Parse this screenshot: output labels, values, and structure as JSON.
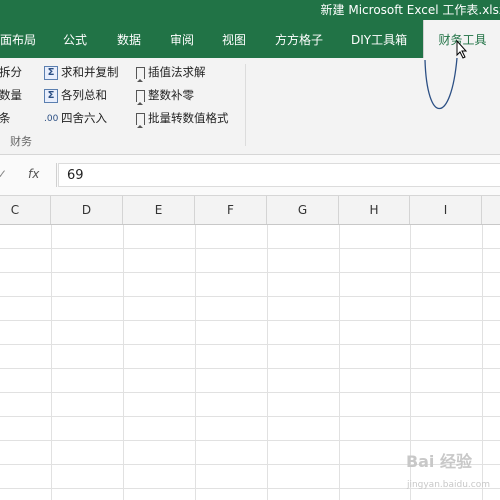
{
  "window": {
    "title": "新建 Microsoft Excel 工作表.xlsx"
  },
  "tabs": [
    {
      "label": "页面布局"
    },
    {
      "label": "公式"
    },
    {
      "label": "数据"
    },
    {
      "label": "审阅"
    },
    {
      "label": "视图"
    },
    {
      "label": "方方格子"
    },
    {
      "label": "DIY工具箱"
    },
    {
      "label": "财务工具",
      "active": true
    }
  ],
  "ribbon": {
    "left_items": [
      "拆分",
      "数量",
      "条"
    ],
    "group_label": "财务",
    "col2": [
      {
        "label": "求和并复制",
        "icon": "sigma-icon"
      },
      {
        "label": "各列总和",
        "icon": "sigma-icon"
      },
      {
        "label": "四舍六入",
        "icon": "round-icon"
      }
    ],
    "col3": [
      {
        "label": "插值法求解",
        "icon": "bookmark-icon"
      },
      {
        "label": "整数补零",
        "icon": "bookmark-icon"
      },
      {
        "label": "批量转数值格式",
        "icon": "bookmark-icon"
      }
    ]
  },
  "formula_bar": {
    "fx": "fx",
    "value": "69"
  },
  "columns": [
    "C",
    "D",
    "E",
    "F",
    "G",
    "H",
    "I"
  ],
  "watermark": {
    "brand": "Bai 经验",
    "url": "jingyan.baidu.com"
  },
  "colors": {
    "excel_green": "#217346",
    "ribbon_bg": "#f3f3f3"
  }
}
